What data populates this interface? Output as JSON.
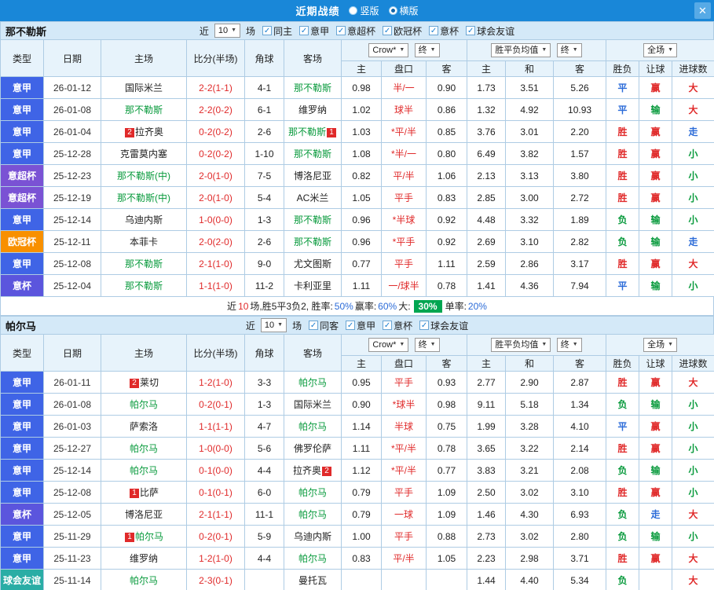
{
  "topbar": {
    "title": "近期战绩",
    "vertical_label": "竖版",
    "horizontal_label": "横版",
    "close_icon": "✕"
  },
  "labels": {
    "near": "近",
    "games": "场"
  },
  "header": {
    "type": "类型",
    "date": "日期",
    "home": "主场",
    "score": "比分(半场)",
    "corner": "角球",
    "away": "客场",
    "odds_source": "Crow*",
    "final": "终",
    "avg": "胜平负均值",
    "scope": "全场",
    "odd_home": "主",
    "odd_hcap": "盘口",
    "odd_away": "客",
    "avg_home": "主",
    "avg_draw": "和",
    "avg_away": "客",
    "result": "胜负",
    "hresult": "让球",
    "goals": "进球数"
  },
  "type_colors": {
    "意甲": "#3f64e6",
    "意超杯": "#7a52d4",
    "欧冠杯": "#f89000",
    "意杯": "#5b55dd",
    "球会友谊": "#2aada5"
  },
  "outcome_colors": {
    "胜": "#e02a2a",
    "平": "#2b6bd8",
    "负": "#089a3c",
    "赢": "#e02a2a",
    "输": "#089a3c",
    "走": "#2b6bd8",
    "大": "#e02a2a",
    "小": "#089a3c"
  },
  "sections": [
    {
      "team": "那不勒斯",
      "near_count": "10",
      "checkboxes": [
        {
          "label": "同主",
          "checked": true
        },
        {
          "label": "意甲",
          "checked": true
        },
        {
          "label": "意超杯",
          "checked": true
        },
        {
          "label": "欧冠杯",
          "checked": true
        },
        {
          "label": "意杯",
          "checked": true
        },
        {
          "label": "球会友谊",
          "checked": true
        }
      ],
      "rows": [
        {
          "type": "意甲",
          "date": "26-01-12",
          "home": {
            "pre": "",
            "name": "国际米兰",
            "post": "",
            "green": false
          },
          "score": "2-2(1-1)",
          "corner": "4-1",
          "away": {
            "pre": "",
            "name": "那不勒斯",
            "post": "",
            "green": true
          },
          "o1": "0.98",
          "hcap": "半/一",
          "o2": "0.90",
          "a1": "1.73",
          "a2": "3.51",
          "a3": "5.26",
          "r": "平",
          "h": "赢",
          "g": "大"
        },
        {
          "type": "意甲",
          "date": "26-01-08",
          "home": {
            "pre": "",
            "name": "那不勒斯",
            "post": "",
            "green": true
          },
          "score": "2-2(0-2)",
          "corner": "6-1",
          "away": {
            "pre": "",
            "name": "维罗纳",
            "post": "",
            "green": false
          },
          "o1": "1.02",
          "hcap": "球半",
          "o2": "0.86",
          "a1": "1.32",
          "a2": "4.92",
          "a3": "10.93",
          "r": "平",
          "h": "输",
          "g": "大"
        },
        {
          "type": "意甲",
          "date": "26-01-04",
          "home": {
            "pre": "2",
            "name": "拉齐奥",
            "post": "",
            "green": false
          },
          "score": "0-2(0-2)",
          "corner": "2-6",
          "away": {
            "pre": "",
            "name": "那不勒斯",
            "post": "1",
            "green": true
          },
          "o1": "1.03",
          "hcap": "*平/半",
          "o2": "0.85",
          "a1": "3.76",
          "a2": "3.01",
          "a3": "2.20",
          "r": "胜",
          "h": "赢",
          "g": "走"
        },
        {
          "type": "意甲",
          "date": "25-12-28",
          "home": {
            "pre": "",
            "name": "克雷莫内塞",
            "post": "",
            "green": false
          },
          "score": "0-2(0-2)",
          "corner": "1-10",
          "away": {
            "pre": "",
            "name": "那不勒斯",
            "post": "",
            "green": true
          },
          "o1": "1.08",
          "hcap": "*半/一",
          "o2": "0.80",
          "a1": "6.49",
          "a2": "3.82",
          "a3": "1.57",
          "r": "胜",
          "h": "赢",
          "g": "小"
        },
        {
          "type": "意超杯",
          "date": "25-12-23",
          "home": {
            "pre": "",
            "name": "那不勒斯(中)",
            "post": "",
            "green": true
          },
          "score": "2-0(1-0)",
          "corner": "7-5",
          "away": {
            "pre": "",
            "name": "博洛尼亚",
            "post": "",
            "green": false
          },
          "o1": "0.82",
          "hcap": "平/半",
          "o2": "1.06",
          "a1": "2.13",
          "a2": "3.13",
          "a3": "3.80",
          "r": "胜",
          "h": "赢",
          "g": "小"
        },
        {
          "type": "意超杯",
          "date": "25-12-19",
          "home": {
            "pre": "",
            "name": "那不勒斯(中)",
            "post": "",
            "green": true
          },
          "score": "2-0(1-0)",
          "corner": "5-4",
          "away": {
            "pre": "",
            "name": "AC米兰",
            "post": "",
            "green": false
          },
          "o1": "1.05",
          "hcap": "平手",
          "o2": "0.83",
          "a1": "2.85",
          "a2": "3.00",
          "a3": "2.72",
          "r": "胜",
          "h": "赢",
          "g": "小"
        },
        {
          "type": "意甲",
          "date": "25-12-14",
          "home": {
            "pre": "",
            "name": "乌迪内斯",
            "post": "",
            "green": false
          },
          "score": "1-0(0-0)",
          "corner": "1-3",
          "away": {
            "pre": "",
            "name": "那不勒斯",
            "post": "",
            "green": true
          },
          "o1": "0.96",
          "hcap": "*半球",
          "o2": "0.92",
          "a1": "4.48",
          "a2": "3.32",
          "a3": "1.89",
          "r": "负",
          "h": "输",
          "g": "小"
        },
        {
          "type": "欧冠杯",
          "date": "25-12-11",
          "home": {
            "pre": "",
            "name": "本菲卡",
            "post": "",
            "green": false
          },
          "score": "2-0(2-0)",
          "corner": "2-6",
          "away": {
            "pre": "",
            "name": "那不勒斯",
            "post": "",
            "green": true
          },
          "o1": "0.96",
          "hcap": "*平手",
          "o2": "0.92",
          "a1": "2.69",
          "a2": "3.10",
          "a3": "2.82",
          "r": "负",
          "h": "输",
          "g": "走"
        },
        {
          "type": "意甲",
          "date": "25-12-08",
          "home": {
            "pre": "",
            "name": "那不勒斯",
            "post": "",
            "green": true
          },
          "score": "2-1(1-0)",
          "corner": "9-0",
          "away": {
            "pre": "",
            "name": "尤文图斯",
            "post": "",
            "green": false
          },
          "o1": "0.77",
          "hcap": "平手",
          "o2": "1.11",
          "a1": "2.59",
          "a2": "2.86",
          "a3": "3.17",
          "r": "胜",
          "h": "赢",
          "g": "大"
        },
        {
          "type": "意杯",
          "date": "25-12-04",
          "home": {
            "pre": "",
            "name": "那不勒斯",
            "post": "",
            "green": true
          },
          "score": "1-1(1-0)",
          "corner": "11-2",
          "away": {
            "pre": "",
            "name": "卡利亚里",
            "post": "",
            "green": false
          },
          "o1": "1.11",
          "hcap": "一/球半",
          "o2": "0.78",
          "a1": "1.41",
          "a2": "4.36",
          "a3": "7.94",
          "r": "平",
          "h": "输",
          "g": "小"
        }
      ],
      "summary": [
        {
          "t": "近",
          "c": "k"
        },
        {
          "t": "10",
          "c": "r"
        },
        {
          "t": "场,胜5平3负2, 胜率:",
          "c": "k"
        },
        {
          "t": "50%",
          "c": "b"
        },
        {
          "t": " 赢率:",
          "c": "k"
        },
        {
          "t": "60%",
          "c": "b"
        },
        {
          "t": " 大: ",
          "c": "k"
        },
        {
          "t": "30%",
          "c": "gbox"
        },
        {
          "t": " 单率:",
          "c": "k"
        },
        {
          "t": "20%",
          "c": "b"
        }
      ]
    },
    {
      "team": "帕尔马",
      "near_count": "10",
      "checkboxes": [
        {
          "label": "同客",
          "checked": true
        },
        {
          "label": "意甲",
          "checked": true
        },
        {
          "label": "意杯",
          "checked": true
        },
        {
          "label": "球会友谊",
          "checked": true
        }
      ],
      "rows": [
        {
          "type": "意甲",
          "date": "26-01-11",
          "home": {
            "pre": "2",
            "name": "莱切",
            "post": "",
            "green": false
          },
          "score": "1-2(1-0)",
          "corner": "3-3",
          "away": {
            "pre": "",
            "name": "帕尔马",
            "post": "",
            "green": true
          },
          "o1": "0.95",
          "hcap": "平手",
          "o2": "0.93",
          "a1": "2.77",
          "a2": "2.90",
          "a3": "2.87",
          "r": "胜",
          "h": "赢",
          "g": "大"
        },
        {
          "type": "意甲",
          "date": "26-01-08",
          "home": {
            "pre": "",
            "name": "帕尔马",
            "post": "",
            "green": true
          },
          "score": "0-2(0-1)",
          "corner": "1-3",
          "away": {
            "pre": "",
            "name": "国际米兰",
            "post": "",
            "green": false
          },
          "o1": "0.90",
          "hcap": "*球半",
          "o2": "0.98",
          "a1": "9.11",
          "a2": "5.18",
          "a3": "1.34",
          "r": "负",
          "h": "输",
          "g": "小"
        },
        {
          "type": "意甲",
          "date": "26-01-03",
          "home": {
            "pre": "",
            "name": "萨索洛",
            "post": "",
            "green": false
          },
          "score": "1-1(1-1)",
          "corner": "4-7",
          "away": {
            "pre": "",
            "name": "帕尔马",
            "post": "",
            "green": true
          },
          "o1": "1.14",
          "hcap": "半球",
          "o2": "0.75",
          "a1": "1.99",
          "a2": "3.28",
          "a3": "4.10",
          "r": "平",
          "h": "赢",
          "g": "小"
        },
        {
          "type": "意甲",
          "date": "25-12-27",
          "home": {
            "pre": "",
            "name": "帕尔马",
            "post": "",
            "green": true
          },
          "score": "1-0(0-0)",
          "corner": "5-6",
          "away": {
            "pre": "",
            "name": "佛罗伦萨",
            "post": "",
            "green": false
          },
          "o1": "1.11",
          "hcap": "*平/半",
          "o2": "0.78",
          "a1": "3.65",
          "a2": "3.22",
          "a3": "2.14",
          "r": "胜",
          "h": "赢",
          "g": "小"
        },
        {
          "type": "意甲",
          "date": "25-12-14",
          "home": {
            "pre": "",
            "name": "帕尔马",
            "post": "",
            "green": true
          },
          "score": "0-1(0-0)",
          "corner": "4-4",
          "away": {
            "pre": "",
            "name": "拉齐奥",
            "post": "2",
            "green": false
          },
          "o1": "1.12",
          "hcap": "*平/半",
          "o2": "0.77",
          "a1": "3.83",
          "a2": "3.21",
          "a3": "2.08",
          "r": "负",
          "h": "输",
          "g": "小"
        },
        {
          "type": "意甲",
          "date": "25-12-08",
          "home": {
            "pre": "1",
            "name": "比萨",
            "post": "",
            "green": false
          },
          "score": "0-1(0-1)",
          "corner": "6-0",
          "away": {
            "pre": "",
            "name": "帕尔马",
            "post": "",
            "green": true
          },
          "o1": "0.79",
          "hcap": "平手",
          "o2": "1.09",
          "a1": "2.50",
          "a2": "3.02",
          "a3": "3.10",
          "r": "胜",
          "h": "赢",
          "g": "小"
        },
        {
          "type": "意杯",
          "date": "25-12-05",
          "home": {
            "pre": "",
            "name": "博洛尼亚",
            "post": "",
            "green": false
          },
          "score": "2-1(1-1)",
          "corner": "11-1",
          "away": {
            "pre": "",
            "name": "帕尔马",
            "post": "",
            "green": true
          },
          "o1": "0.79",
          "hcap": "一球",
          "o2": "1.09",
          "a1": "1.46",
          "a2": "4.30",
          "a3": "6.93",
          "r": "负",
          "h": "走",
          "g": "大"
        },
        {
          "type": "意甲",
          "date": "25-11-29",
          "home": {
            "pre": "1",
            "name": "帕尔马",
            "post": "",
            "green": true
          },
          "score": "0-2(0-1)",
          "corner": "5-9",
          "away": {
            "pre": "",
            "name": "乌迪内斯",
            "post": "",
            "green": false
          },
          "o1": "1.00",
          "hcap": "平手",
          "o2": "0.88",
          "a1": "2.73",
          "a2": "3.02",
          "a3": "2.80",
          "r": "负",
          "h": "输",
          "g": "小"
        },
        {
          "type": "意甲",
          "date": "25-11-23",
          "home": {
            "pre": "",
            "name": "维罗纳",
            "post": "",
            "green": false
          },
          "score": "1-2(1-0)",
          "corner": "4-4",
          "away": {
            "pre": "",
            "name": "帕尔马",
            "post": "",
            "green": true
          },
          "o1": "0.83",
          "hcap": "平/半",
          "o2": "1.05",
          "a1": "2.23",
          "a2": "2.98",
          "a3": "3.71",
          "r": "胜",
          "h": "赢",
          "g": "大"
        },
        {
          "type": "球会友谊",
          "date": "25-11-14",
          "home": {
            "pre": "",
            "name": "帕尔马",
            "post": "",
            "green": true
          },
          "score": "2-3(0-1)",
          "corner": "",
          "away": {
            "pre": "",
            "name": "曼托瓦",
            "post": "",
            "green": false
          },
          "o1": "",
          "hcap": "",
          "o2": "",
          "a1": "1.44",
          "a2": "4.40",
          "a3": "5.34",
          "r": "负",
          "h": "",
          "g": "大"
        }
      ]
    }
  ]
}
